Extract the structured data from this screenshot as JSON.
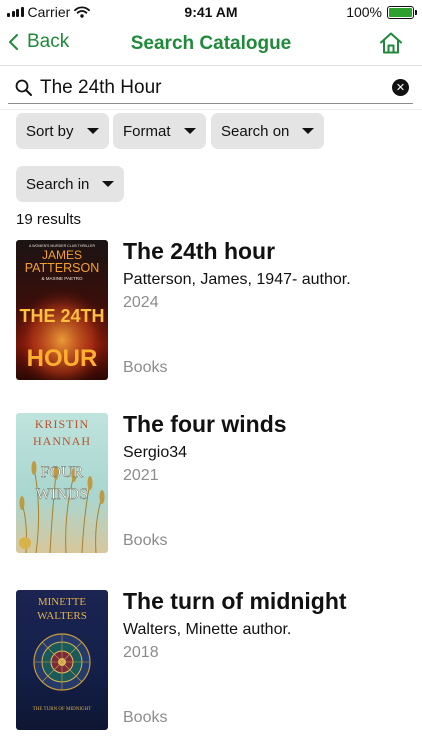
{
  "status_bar": {
    "carrier": "Carrier",
    "time": "9:41 AM",
    "battery": "100%"
  },
  "nav": {
    "back_label": "Back",
    "title": "Search Catalogue"
  },
  "search": {
    "value": "The 24th Hour",
    "clear": "✕"
  },
  "filters": [
    {
      "label": "Sort by"
    },
    {
      "label": "Format"
    },
    {
      "label": "Search on"
    },
    {
      "label": "Search in"
    }
  ],
  "results_count": "19 results",
  "results": [
    {
      "title": "The 24th hour",
      "author": "Patterson, James, 1947- author.",
      "year": "2024",
      "format": "Books",
      "cover": {
        "tagline": "A WOMEN'S MURDER CLUB THRILLER",
        "author_line1": "JAMES",
        "author_line2": "PATTERSON",
        "coauthor": "& MAXINE PAETRO",
        "big_text": "THE 24TH",
        "bottom_text": "HOUR"
      }
    },
    {
      "title": "The four winds",
      "author": "Sergio34",
      "year": "2021",
      "format": "Books",
      "cover": {
        "author_line1": "KRISTIN",
        "author_line2": "HANNAH",
        "word1": "FOUR",
        "word2": "WINDS"
      }
    },
    {
      "title": "The turn of midnight",
      "author": "Walters, Minette author.",
      "year": "2018",
      "format": "Books",
      "cover": {
        "author_line1": "MINETTE",
        "author_line2": "WALTERS",
        "title_text": "THE TURN OF MIDNIGHT"
      }
    }
  ],
  "colors": {
    "accent": "#1f8a3a",
    "chip_bg": "#e4e4e4",
    "muted_text": "#8c8c8c",
    "battery": "#2da02d"
  }
}
